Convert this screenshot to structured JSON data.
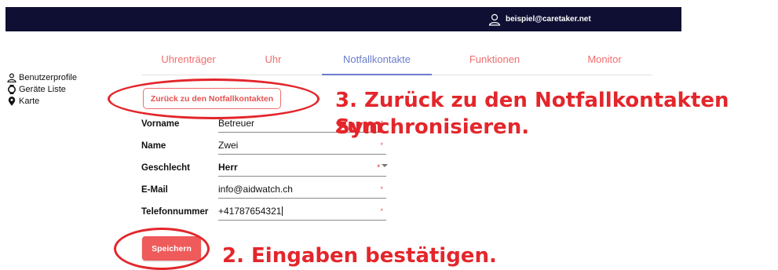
{
  "header": {
    "user_email": "beispiel@caretaker.net"
  },
  "sidebar": {
    "items": [
      {
        "label": "Benutzerprofile",
        "icon": "person-icon"
      },
      {
        "label": "Geräte Liste",
        "icon": "watch-icon"
      },
      {
        "label": "Karte",
        "icon": "map-pin-icon"
      }
    ]
  },
  "tabs": [
    {
      "label": "Uhrenträger"
    },
    {
      "label": "Uhr"
    },
    {
      "label": "Notfallkontakte",
      "active": true
    },
    {
      "label": "Funktionen"
    },
    {
      "label": "Monitor"
    }
  ],
  "back_button": {
    "label": "Zurück zu den Notfallkontakten"
  },
  "form": {
    "fields": [
      {
        "label": "Vorname",
        "value": "Betreuer",
        "required_mark": "*"
      },
      {
        "label": "Name",
        "value": "Zwei",
        "required_mark": "*"
      },
      {
        "label": "Geschlecht",
        "value": "Herr",
        "required_mark": "*"
      },
      {
        "label": "E-Mail",
        "value": "info@aidwatch.ch",
        "required_mark": "*"
      },
      {
        "label": "Telefonnummer",
        "value": "+41787654321",
        "required_mark": "*"
      }
    ],
    "save_label": "Speichern"
  },
  "annotations": {
    "step3_line1": "3. Zurück zu den Notfallkontakten zum",
    "step3_line2": "Synchronisieren.",
    "step2": "2. Eingaben bestätigen."
  },
  "colors": {
    "accent": "#f06d6d",
    "active_tab": "#6b7dcc",
    "annotation": "#e3262b",
    "topbar": "#0f0f33"
  }
}
